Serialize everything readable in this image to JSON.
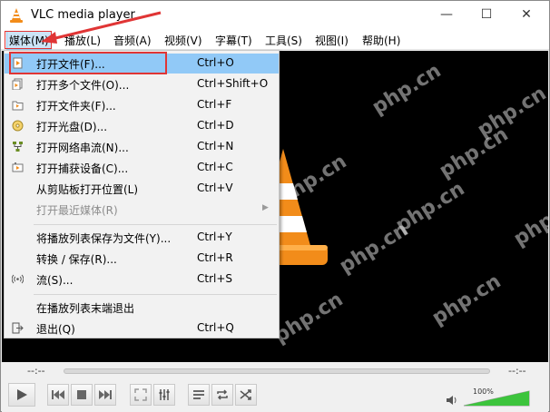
{
  "window": {
    "title": "VLC media player",
    "controls": {
      "minimize": "—",
      "maximize": "☐",
      "close": "✕"
    }
  },
  "menubar": {
    "items": [
      {
        "label": "媒体(M)"
      },
      {
        "label": "播放(L)"
      },
      {
        "label": "音频(A)"
      },
      {
        "label": "视频(V)"
      },
      {
        "label": "字幕(T)"
      },
      {
        "label": "工具(S)"
      },
      {
        "label": "视图(I)"
      },
      {
        "label": "帮助(H)"
      }
    ]
  },
  "media_menu": {
    "items": [
      {
        "label": "打开文件(F)...",
        "shortcut": "Ctrl+O",
        "icon": "open-file-icon",
        "highlighted": true
      },
      {
        "label": "打开多个文件(O)...",
        "shortcut": "Ctrl+Shift+O",
        "icon": "open-multiple-files-icon"
      },
      {
        "label": "打开文件夹(F)...",
        "shortcut": "Ctrl+F",
        "icon": "open-folder-icon"
      },
      {
        "label": "打开光盘(D)...",
        "shortcut": "Ctrl+D",
        "icon": "disc-icon"
      },
      {
        "label": "打开网络串流(N)...",
        "shortcut": "Ctrl+N",
        "icon": "network-icon"
      },
      {
        "label": "打开捕获设备(C)...",
        "shortcut": "Ctrl+C",
        "icon": "capture-device-icon"
      },
      {
        "label": "从剪贴板打开位置(L)",
        "shortcut": "Ctrl+V",
        "icon": ""
      },
      {
        "label": "打开最近媒体(R)",
        "shortcut": "",
        "icon": "",
        "disabled": true,
        "submenu": true
      },
      {
        "label": "将播放列表保存为文件(Y)...",
        "shortcut": "Ctrl+Y",
        "icon": ""
      },
      {
        "label": "转换 / 保存(R)...",
        "shortcut": "Ctrl+R",
        "icon": ""
      },
      {
        "label": "流(S)...",
        "shortcut": "Ctrl+S",
        "icon": "stream-icon"
      },
      {
        "label": "在播放列表末端退出",
        "shortcut": "",
        "icon": ""
      },
      {
        "label": "退出(Q)",
        "shortcut": "Ctrl+Q",
        "icon": "quit-icon"
      }
    ]
  },
  "player": {
    "time_elapsed": "--:--",
    "time_total": "--:--",
    "volume_percent": "100%",
    "volume_level": 1.0,
    "seek_progress": 0
  },
  "watermarks": [
    "php.cn",
    "php.cn",
    "php.cn",
    "php.cn",
    "php.cn",
    "php.cn",
    "php.cn",
    "php.cn",
    "php.cn"
  ],
  "colors": {
    "highlight": "#91c9f7",
    "annotation_red": "#e03535",
    "cone_orange": "#f28c1a",
    "volume_green": "#3cc43c"
  }
}
